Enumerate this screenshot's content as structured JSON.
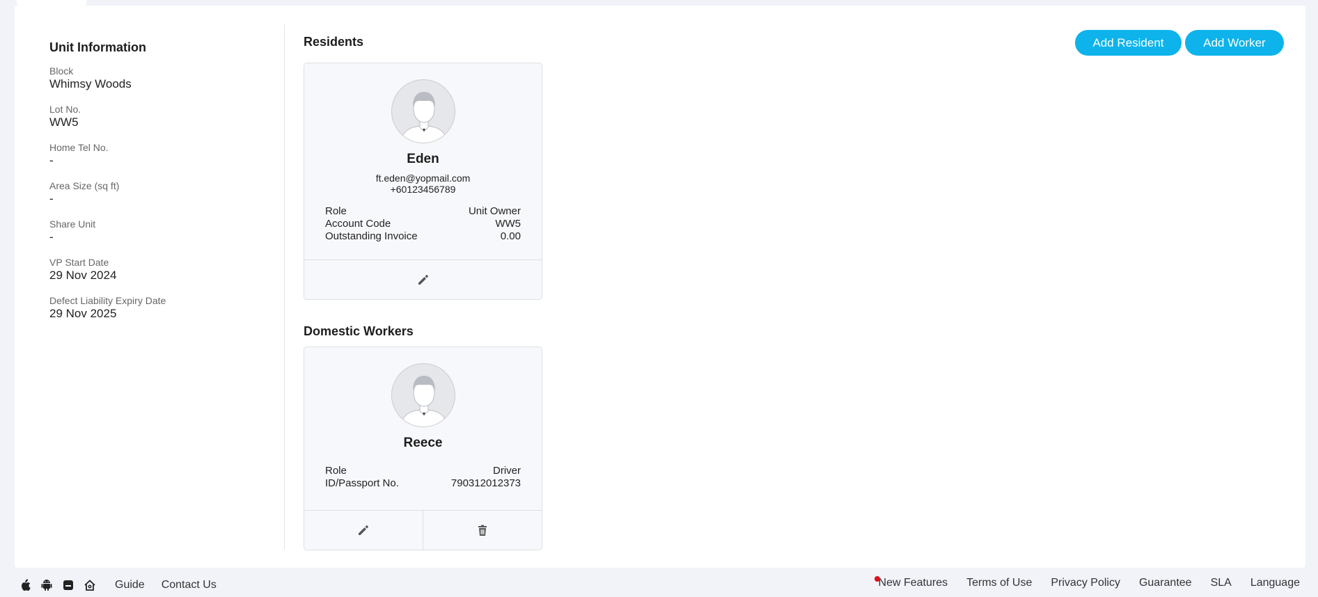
{
  "unit_info": {
    "title": "Unit Information",
    "fields": [
      {
        "label": "Block",
        "value": "Whimsy Woods"
      },
      {
        "label": "Lot No.",
        "value": "WW5"
      },
      {
        "label": "Home Tel No.",
        "value": "-"
      },
      {
        "label": "Area Size (sq ft)",
        "value": "-"
      },
      {
        "label": "Share Unit",
        "value": "-"
      },
      {
        "label": "VP Start Date",
        "value": "29 Nov 2024"
      },
      {
        "label": "Defect Liability Expiry Date",
        "value": "29 Nov 2025"
      }
    ]
  },
  "residents": {
    "title": "Residents",
    "add_resident_label": "Add Resident",
    "add_worker_label": "Add Worker",
    "card": {
      "name": "Eden",
      "email": "ft.eden@yopmail.com",
      "phone": "+60123456789",
      "rows": [
        {
          "label": "Role",
          "value": "Unit Owner"
        },
        {
          "label": "Account Code",
          "value": "WW5"
        },
        {
          "label": "Outstanding Invoice",
          "value": "0.00"
        }
      ],
      "actions": [
        "pencil-icon"
      ]
    }
  },
  "workers": {
    "title": "Domestic Workers",
    "card": {
      "name": "Reece",
      "rows": [
        {
          "label": "Role",
          "value": "Driver"
        },
        {
          "label": "ID/Passport No.",
          "value": "790312012373"
        }
      ],
      "actions": [
        "pencil-icon",
        "trash-icon"
      ]
    }
  },
  "footer": {
    "icons": [
      "apple-icon",
      "android-icon",
      "mobile-app-icon",
      "home-icon"
    ],
    "left_links": [
      "Guide",
      "Contact Us"
    ],
    "right_links": [
      "New Features",
      "Terms of Use",
      "Privacy Policy",
      "Guarantee",
      "SLA",
      "Language"
    ],
    "accent_color": "#0db3ea",
    "notification_dot_color": "#e0101a"
  }
}
